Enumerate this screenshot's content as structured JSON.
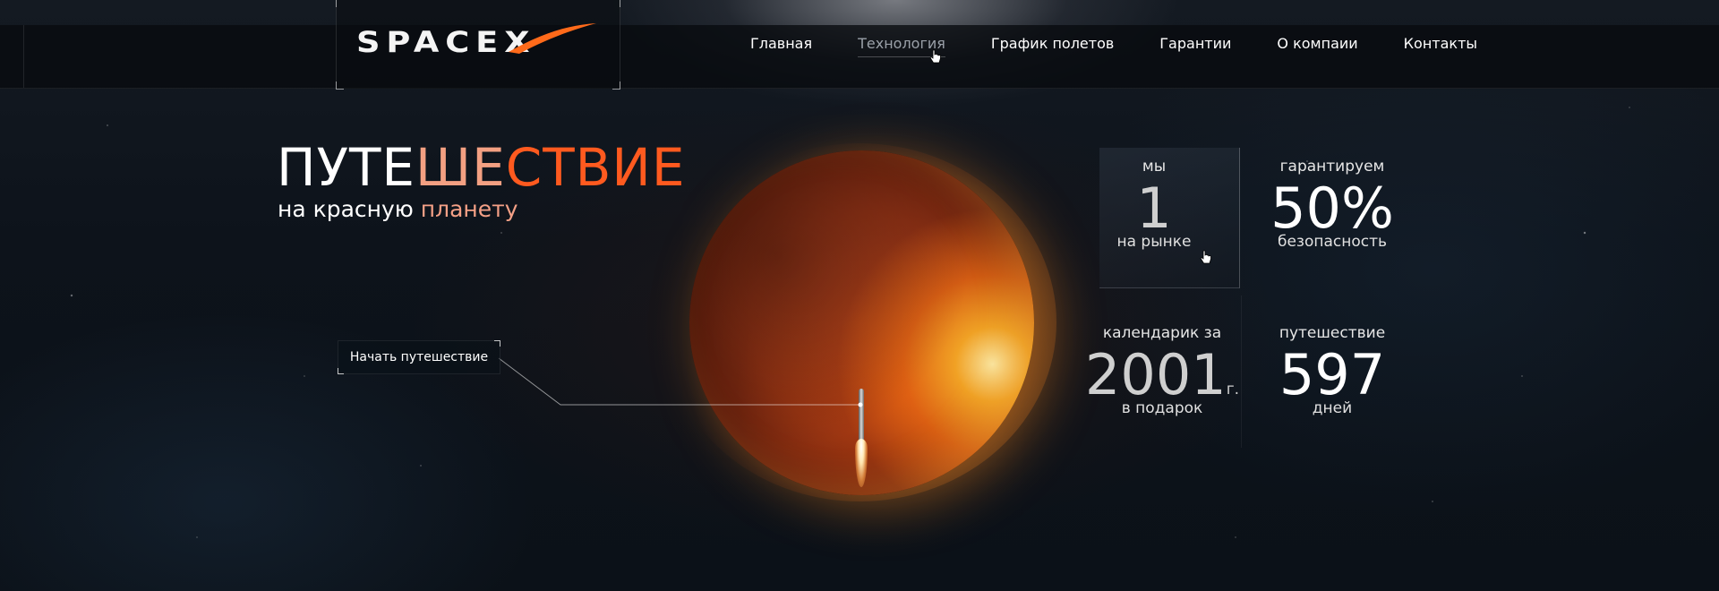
{
  "header": {
    "logo_text": "SPACEX",
    "nav": [
      {
        "label": "Главная",
        "active": false
      },
      {
        "label": "Технология",
        "active": true
      },
      {
        "label": "График полетов",
        "active": false
      },
      {
        "label": "Гарантии",
        "active": false
      },
      {
        "label": "О компаии",
        "active": false
      },
      {
        "label": "Контакты",
        "active": false
      }
    ]
  },
  "hero": {
    "title_part1": "ПУТЕ",
    "title_part2": "ШЕ",
    "title_part3": "СТВИЕ",
    "subtitle_prefix": "на красную ",
    "subtitle_accent": "планету",
    "start_button": "Начать путешествие"
  },
  "stats": {
    "market": {
      "label": "мы",
      "value": "1",
      "caption": "на рынке"
    },
    "safety": {
      "label": "гарантируем",
      "value": "50%",
      "caption": "безопасность"
    },
    "calendar": {
      "label": "календарик за",
      "value": "2001",
      "unit": "г.",
      "caption": "в подарок"
    },
    "trip": {
      "label": "путешествие",
      "value": "597",
      "caption": "дней"
    }
  },
  "colors": {
    "accent_orange": "#ff5a1f",
    "accent_peach": "#f4a086",
    "background": "#0d131b"
  },
  "icons": {
    "cursor": "hand-pointer-icon",
    "logo_swoosh": "swoosh-icon"
  }
}
